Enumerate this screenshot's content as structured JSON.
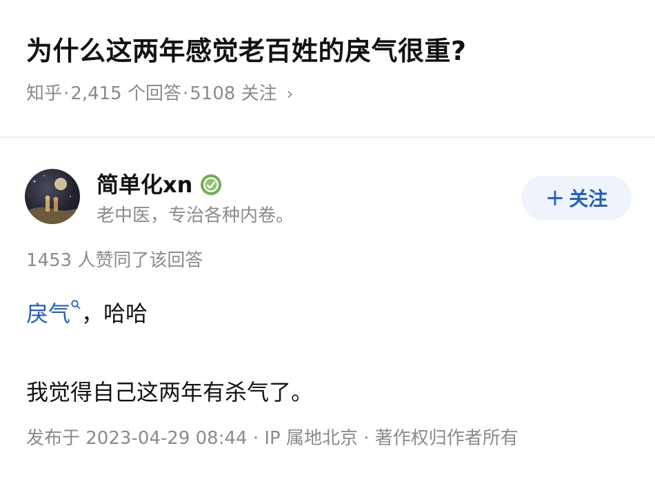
{
  "question": {
    "title": "为什么这两年感觉老百姓的戾气很重?",
    "source": "知乎",
    "answer_count": "2,415 个回答",
    "follower_count": "5108 关注",
    "separator": "·",
    "chevron": "›"
  },
  "author": {
    "name": "简单化xn",
    "bio": "老中医，专治各种内卷。",
    "badge_icon": "verified-badge-icon",
    "follow_button_plus": "+",
    "follow_button_label": "关注"
  },
  "answer": {
    "vote_summary": "1453 人赞同了该回答",
    "link_term": "戾气",
    "line1_suffix": "，哈哈",
    "line2": "我觉得自己这两年有杀气了。",
    "footer": "发布于 2023-04-29 08:44 · IP 属地北京 · 著作权归作者所有"
  },
  "colors": {
    "link_blue": "#1f5fc7",
    "meta_gray": "#8a8a8a",
    "follow_bg": "#eef3fc",
    "badge_green": "#6ab04c"
  }
}
